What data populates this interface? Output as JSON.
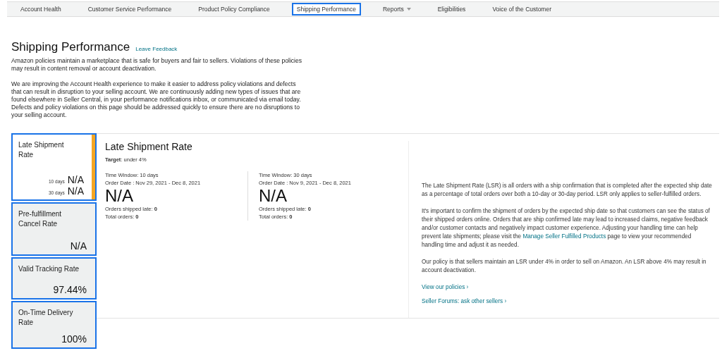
{
  "nav": {
    "tabs": [
      {
        "label": "Account Health",
        "selected": false
      },
      {
        "label": "Customer Service Performance",
        "selected": false
      },
      {
        "label": "Product Policy Compliance",
        "selected": false
      },
      {
        "label": "Shipping Performance",
        "selected": true
      },
      {
        "label": "Reports",
        "selected": false,
        "dropdown": true
      },
      {
        "label": "Eligibilities",
        "selected": false
      },
      {
        "label": "Voice of the Customer",
        "selected": false
      }
    ]
  },
  "header": {
    "title": "Shipping Performance",
    "feedback_link": "Leave Feedback"
  },
  "intro": [
    "Amazon policies maintain a marketplace that is safe for buyers and fair to sellers. Violations of these policies may result in content removal or account deactivation.",
    "We are improving the Account Health experience to make it easier to address policy violations and defects that can result in disruption to your selling account. We are continuously adding new types of issues that are found elsewhere in Seller Central, in your performance notifications inbox, or communicated via email today. Defects and policy violations on this page should be addressed quickly to ensure there are no disruptions to your selling account."
  ],
  "metrics": [
    {
      "title": "Late Shipment Rate",
      "selected": true,
      "values": [
        {
          "label": "10 days",
          "value": "N/A"
        },
        {
          "label": "30 days",
          "value": "N/A"
        }
      ]
    },
    {
      "title": "Pre-fulfillment Cancel Rate",
      "selected": false,
      "values": [
        {
          "value": "N/A"
        }
      ]
    },
    {
      "title": "Valid Tracking Rate",
      "selected": false,
      "values": [
        {
          "value": "97.44%"
        }
      ]
    },
    {
      "title": "On-Time Delivery Rate",
      "selected": false,
      "values": [
        {
          "value": "100%"
        }
      ]
    }
  ],
  "detail": {
    "title": "Late Shipment Rate",
    "target": "**Target**: under 4%",
    "windows": [
      {
        "window": "Time Window: 10 days",
        "dates": "Order Date : Nov 29, 2021 - Dec 8, 2021",
        "value": "N/A",
        "late": "Orders shipped late: **0**",
        "total": "Total orders: **0**"
      },
      {
        "window": "Time Window: 30 days",
        "dates": "Order Date : Nov 9, 2021 - Dec 8, 2021",
        "value": "N/A",
        "late": "Orders shipped late: **0**",
        "total": "Total orders: **0**"
      }
    ],
    "paragraphs": [
      {
        "text": "The Late Shipment Rate (LSR) is all orders with a ship confirmation that is completed after the expected ship date as a percentage of total orders over both a 10-day or 30-day period. LSR only applies to seller-fulfilled orders."
      },
      {
        "text": "It's important to confirm the shipment of orders by the expected ship date so that customers can see the status of their shipped orders online. Orders that are ship confirmed late may lead to increased claims, negative feedback and/or customer contacts and negatively impact customer experience. Adjusting your handling time can help prevent late shipments; please visit the",
        "link": "Manage Seller Fulfilled Products",
        "after": "page to view your recommended handling time and adjust it as needed."
      },
      {
        "text": "Our policy is that sellers maintain an LSR under 4% in order to sell on Amazon. An LSR above 4% may result in account deactivation."
      }
    ],
    "links": [
      "View our policies ›",
      "Seller Forums: ask other sellers ›"
    ]
  }
}
